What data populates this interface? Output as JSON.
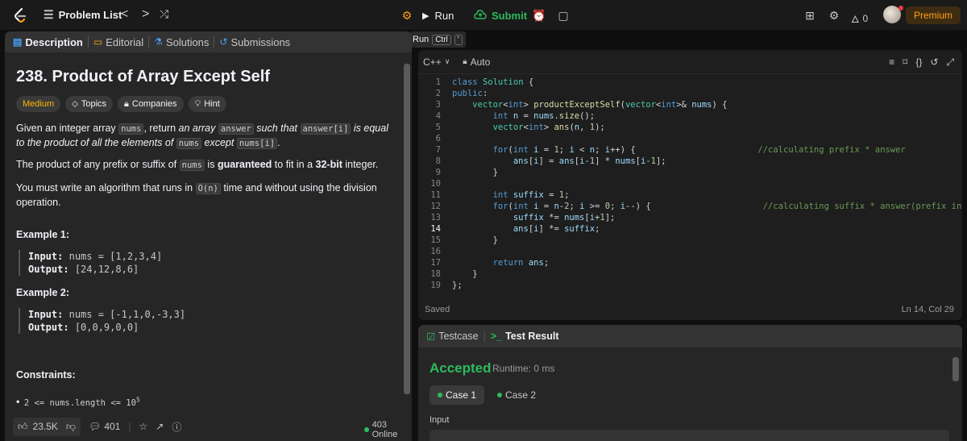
{
  "topbar": {
    "problem_list": "Problem List",
    "prev": "<",
    "next": ">",
    "run": "Run",
    "submit": "Submit",
    "streak_count": "0",
    "premium": "Premium"
  },
  "run_tooltip": {
    "label": "Run",
    "key1": "Ctrl",
    "key2": "'"
  },
  "left_tabs": [
    {
      "label": "Description"
    },
    {
      "label": "Editorial"
    },
    {
      "label": "Solutions"
    },
    {
      "label": "Submissions"
    }
  ],
  "problem": {
    "title": "238. Product of Array Except Self",
    "tags": {
      "difficulty": "Medium",
      "topics": "Topics",
      "companies": "Companies",
      "hint": "Hint"
    },
    "desc1": {
      "a": "Given an integer array ",
      "c1": "nums",
      "b": ", return ",
      "i1": "an array",
      "c2": "answer",
      "i2": "such that",
      "c3": "answer[i]",
      "i3": "is equal to the product of all the elements of",
      "c4": "nums",
      "i4": "except",
      "c5": "nums[i]",
      "end": "."
    },
    "desc2": {
      "a": "The product of any prefix or suffix of ",
      "c1": "nums",
      "b": " is ",
      "bold1": "guaranteed",
      "c": " to fit in a ",
      "bold2": "32-bit",
      "d": " integer."
    },
    "desc3": {
      "a": "You must write an algorithm that runs in ",
      "c1": "O(n)",
      "b": " time and without using the division operation."
    },
    "examples": [
      {
        "title": "Example 1:",
        "input_label": "Input:",
        "input": "nums = [1,2,3,4]",
        "output_label": "Output:",
        "output": "[24,12,8,6]"
      },
      {
        "title": "Example 2:",
        "input_label": "Input:",
        "input": "nums = [-1,1,0,-3,3]",
        "output_label": "Output:",
        "output": "[0,0,9,0,0]"
      }
    ],
    "constraints_title": "Constraints:",
    "constraint1": "2 <= nums.length <= 10",
    "constraint1_sup": "5"
  },
  "footer": {
    "likes": "23.5K",
    "comments": "401",
    "online": "403 Online"
  },
  "editor": {
    "language": "C++",
    "mode": "Auto",
    "saved": "Saved",
    "cursor": "Ln 14, Col 29",
    "current_line": 14
  },
  "results": {
    "tab_testcase": "Testcase",
    "tab_result": "Test Result",
    "status": "Accepted",
    "runtime": "Runtime: 0 ms",
    "case1": "Case 1",
    "case2": "Case 2",
    "input_label": "Input"
  },
  "colors": {
    "accent": "#ffa116",
    "success": "#2cbb5d",
    "medium": "#ffb800"
  }
}
